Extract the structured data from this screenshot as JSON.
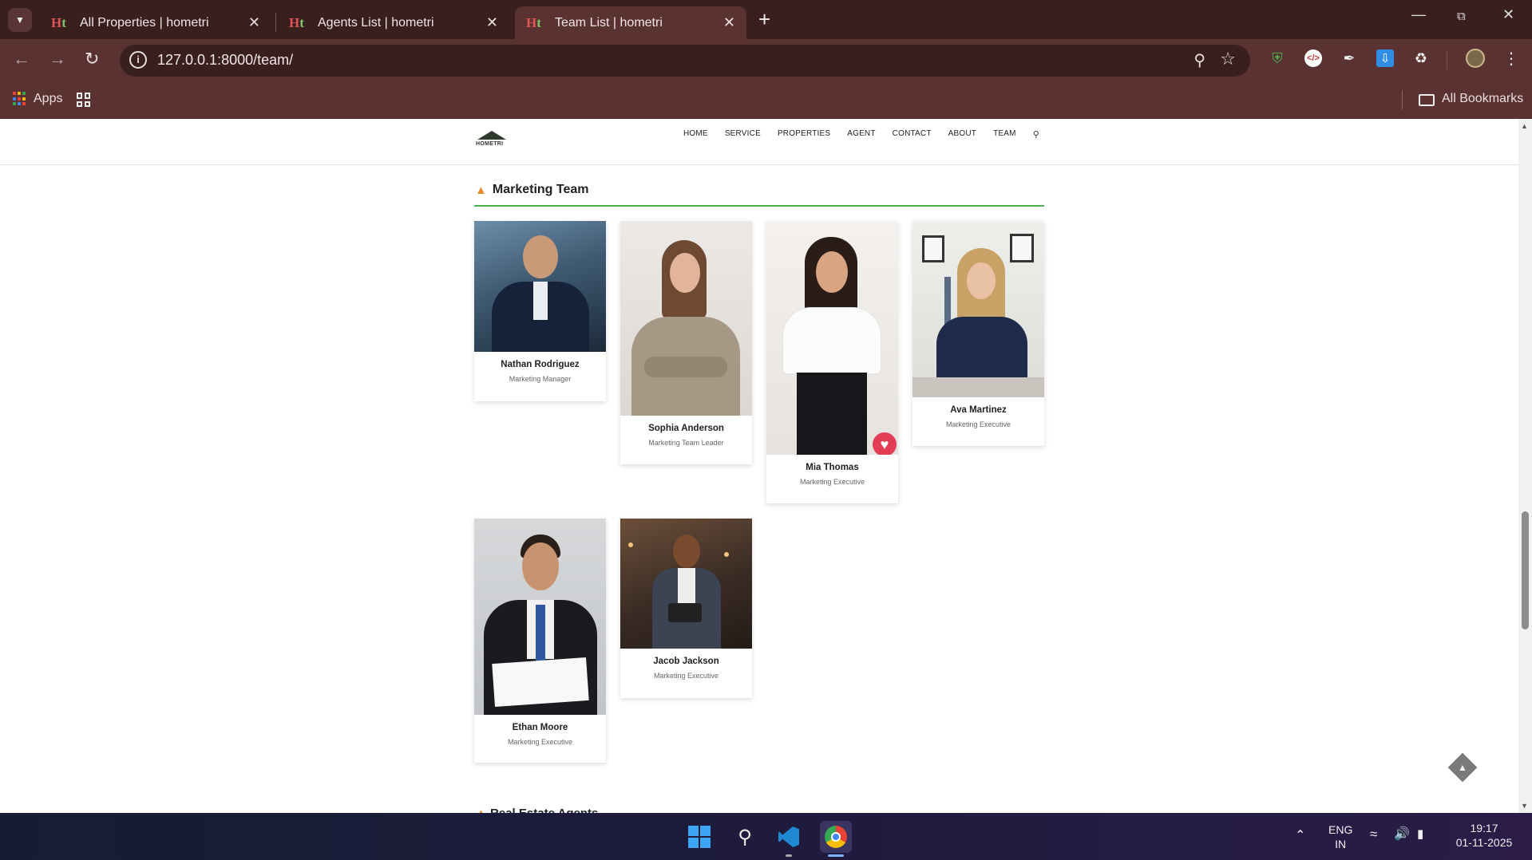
{
  "browser": {
    "tabs": [
      {
        "title": "All Properties | hometri",
        "active": false
      },
      {
        "title": "Agents List | hometri",
        "active": false
      },
      {
        "title": "Team List | hometri",
        "active": true
      }
    ],
    "url": "127.0.0.1:8000/team/",
    "bookmarks": {
      "apps_label": "Apps",
      "all_bookmarks_label": "All Bookmarks"
    }
  },
  "site": {
    "logo_text": "HOMETRI",
    "nav": [
      "HOME",
      "SERVICE",
      "PROPERTIES",
      "AGENT",
      "CONTACT",
      "ABOUT",
      "TEAM"
    ]
  },
  "section": {
    "title": "Marketing Team",
    "next_title": "Real Estate Agents",
    "members": [
      {
        "name": "Nathan Rodriguez",
        "role": "Marketing Manager"
      },
      {
        "name": "Sophia Anderson",
        "role": "Marketing Team Leader"
      },
      {
        "name": "Mia Thomas",
        "role": "Marketing Executive"
      },
      {
        "name": "Ava Martinez",
        "role": "Marketing Executive"
      },
      {
        "name": "Ethan Moore",
        "role": "Marketing Executive"
      },
      {
        "name": "Jacob Jackson",
        "role": "Marketing Executive"
      }
    ]
  },
  "taskbar": {
    "lang_line1": "ENG",
    "lang_line2": "IN",
    "time": "19:17",
    "date": "01-11-2025"
  }
}
